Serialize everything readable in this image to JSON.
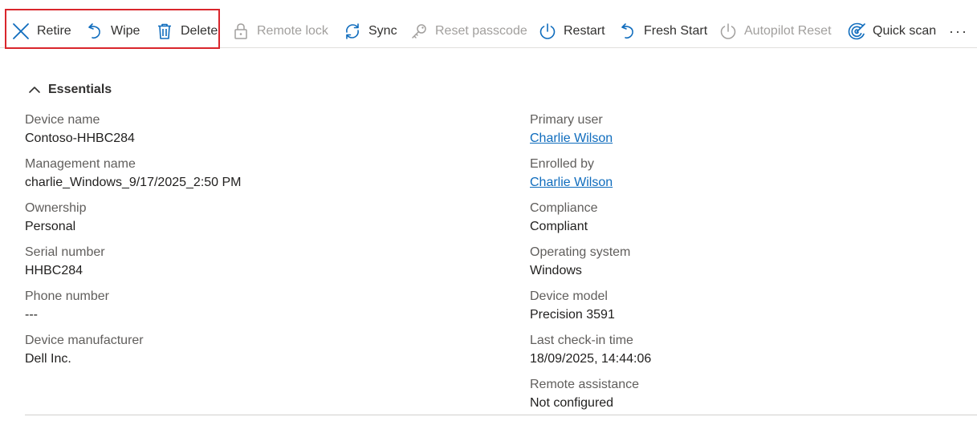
{
  "toolbar": {
    "buttons": [
      {
        "label": "Retire",
        "icon": "close-x-icon",
        "enabled": true
      },
      {
        "label": "Wipe",
        "icon": "undo-icon",
        "enabled": true
      },
      {
        "label": "Delete",
        "icon": "trash-icon",
        "enabled": true
      },
      {
        "label": "Remote lock",
        "icon": "lock-icon",
        "enabled": false
      },
      {
        "label": "Sync",
        "icon": "sync-icon",
        "enabled": true
      },
      {
        "label": "Reset passcode",
        "icon": "key-icon",
        "enabled": false
      },
      {
        "label": "Restart",
        "icon": "power-icon",
        "enabled": true
      },
      {
        "label": "Fresh Start",
        "icon": "undo-icon",
        "enabled": true
      },
      {
        "label": "Autopilot Reset",
        "icon": "power-icon",
        "enabled": false
      },
      {
        "label": "Quick scan",
        "icon": "radar-scan-icon",
        "enabled": true
      }
    ],
    "more": "···"
  },
  "colors": {
    "accent": "#0f6cbd",
    "highlight": "#d9262c",
    "disabled": "#a19f9d"
  },
  "essentials": {
    "title": "Essentials",
    "left": [
      {
        "label": "Device name",
        "value": "Contoso-HHBC284"
      },
      {
        "label": "Management name",
        "value": "charlie_Windows_9/17/2025_2:50 PM"
      },
      {
        "label": "Ownership",
        "value": "Personal"
      },
      {
        "label": "Serial number",
        "value": "HHBC284"
      },
      {
        "label": "Phone number",
        "value": "---"
      },
      {
        "label": "Device manufacturer",
        "value": "Dell Inc."
      }
    ],
    "right": [
      {
        "label": "Primary user",
        "value": "Charlie Wilson",
        "link": true
      },
      {
        "label": "Enrolled by",
        "value": "Charlie Wilson",
        "link": true
      },
      {
        "label": "Compliance",
        "value": "Compliant"
      },
      {
        "label": "Operating system",
        "value": "Windows"
      },
      {
        "label": "Device model",
        "value": "Precision 3591"
      },
      {
        "label": "Last check-in time",
        "value": "18/09/2025, 14:44:06"
      },
      {
        "label": "Remote assistance",
        "value": "Not configured"
      }
    ]
  }
}
